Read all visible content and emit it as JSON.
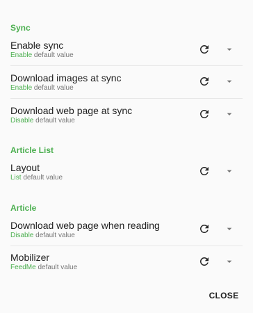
{
  "sections": {
    "sync": {
      "header": "Sync",
      "items": [
        {
          "title": "Enable sync",
          "value": "Enable",
          "suffix": " default value"
        },
        {
          "title": "Download images at sync",
          "value": "Enable",
          "suffix": " default value"
        },
        {
          "title": "Download web page at sync",
          "value": "Disable",
          "suffix": " default value"
        }
      ]
    },
    "article_list": {
      "header": "Article List",
      "items": [
        {
          "title": "Layout",
          "value": "List",
          "suffix": " default value"
        }
      ]
    },
    "article": {
      "header": "Article",
      "items": [
        {
          "title": "Download web page when reading",
          "value": "Disable",
          "suffix": " default value"
        },
        {
          "title": "Mobilizer",
          "value": "FeedMe",
          "suffix": " default value"
        }
      ]
    }
  },
  "icons": {
    "reset": "refresh-icon",
    "dropdown": "chevron-down-icon"
  },
  "colors": {
    "accent": "#4caf50",
    "text": "#212121",
    "secondary": "#757575",
    "icon": "#212121",
    "dropdown": "#757575"
  },
  "footer": {
    "close_label": "CLOSE"
  }
}
